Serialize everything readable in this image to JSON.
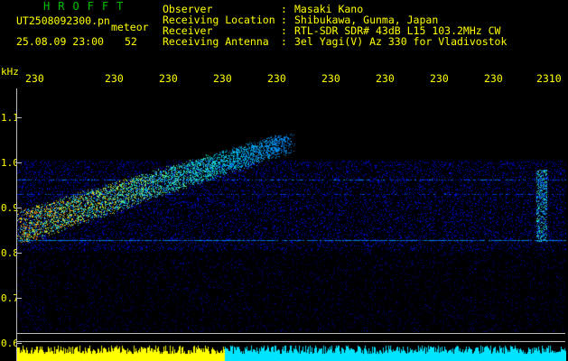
{
  "header": {
    "title": "HROFFT",
    "filename": "UT2508092300.pn",
    "type_label": "meteor",
    "datetime": "25.08.09 23:00",
    "count": "52"
  },
  "info": [
    {
      "label": "Observer",
      "value": "Masaki Kano"
    },
    {
      "label": "Receiving Location",
      "value": "Shibukawa, Gunma, Japan"
    },
    {
      "label": "Receiver",
      "value": "RTL-SDR SDR# 43dB L15 103.2MHz CW"
    },
    {
      "label": "Receiving Antenna",
      "value": "3el Yagi(V) Az 330 for Vladivostok"
    }
  ],
  "separator": ":",
  "y_unit": "kHz",
  "x_ticks": [
    "230",
    "230",
    "230",
    "230",
    "230",
    "230",
    "230",
    "230",
    "230",
    "2310"
  ],
  "y_ticks": [
    "1.1",
    "1.0",
    "0.9",
    "0.8",
    "0.7",
    "0.6"
  ],
  "colors": {
    "label": "#ffff00",
    "title": "#00c000",
    "plot_background": "#000000",
    "echo_low": "#0000c8",
    "echo_high": "#ff8000",
    "bottom_bar_left": "#ffff00",
    "bottom_bar_right": "#00e5ff"
  }
}
